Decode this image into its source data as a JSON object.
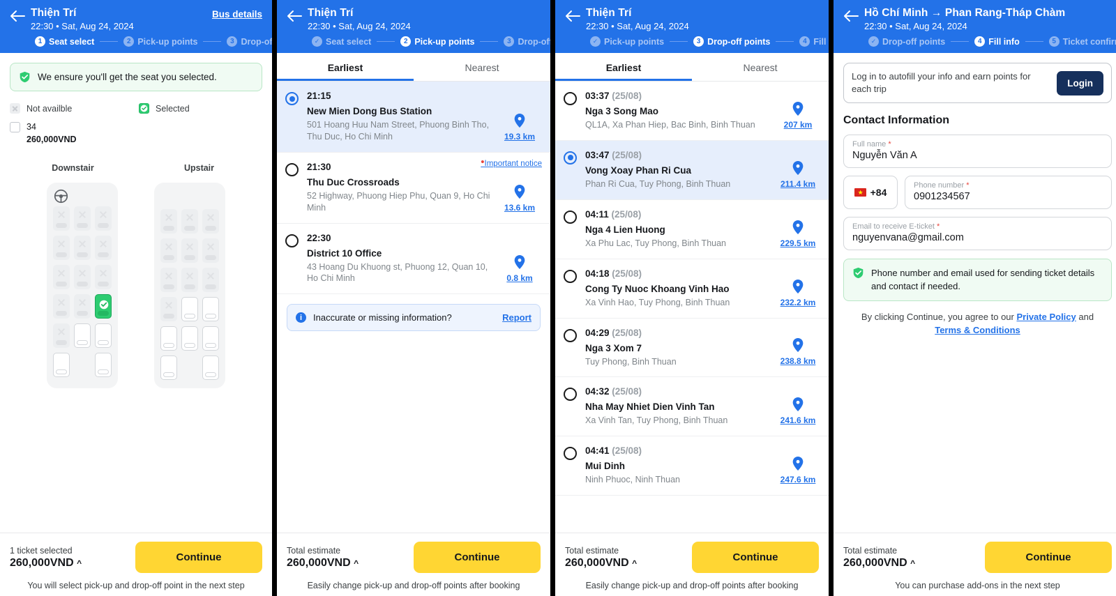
{
  "panels": {
    "seat_select": {
      "header": {
        "title": "Thiện Trí",
        "subtitle": "22:30 • Sat, Aug 24, 2024",
        "bus_details": "Bus details",
        "back_icon": "arrow-left-icon"
      },
      "steps": [
        {
          "num": "1",
          "label": "Seat select",
          "state": "active"
        },
        {
          "num": "2",
          "label": "Pick-up points",
          "state": "upcoming"
        },
        {
          "num": "3",
          "label": "Drop-off points",
          "state": "upcoming"
        }
      ],
      "ensure_banner": {
        "icon": "shield-check-icon",
        "text": "We ensure you'll get the seat you selected."
      },
      "legend": [
        {
          "key": "not_available",
          "label": "Not availble",
          "icon": "seat-unavailable-icon"
        },
        {
          "key": "selected",
          "label": "Selected",
          "icon": "seat-selected-icon"
        }
      ],
      "selected_seat": {
        "icon": "seat-available-icon",
        "number": "34",
        "price": "260,000VND"
      },
      "decks": [
        {
          "name": "Downstair",
          "has_wheel": true,
          "rows": [
            [
              "na",
              "na",
              "na"
            ],
            [
              "na",
              "na",
              "na"
            ],
            [
              "na",
              "na",
              "na"
            ],
            [
              "na",
              "na",
              "sel"
            ],
            [
              "na",
              "av",
              "av"
            ],
            [
              "av",
              "blank",
              "av"
            ]
          ]
        },
        {
          "name": "Upstair",
          "has_wheel": false,
          "rows": [
            [
              "na",
              "na",
              "na"
            ],
            [
              "na",
              "na",
              "na"
            ],
            [
              "na",
              "na",
              "na"
            ],
            [
              "na",
              "av",
              "av"
            ],
            [
              "av",
              "av",
              "av"
            ],
            [
              "av",
              "blank",
              "av"
            ]
          ]
        }
      ],
      "footer": {
        "label": "1 ticket selected",
        "price": "260,000VND",
        "caret": "^",
        "button": "Continue",
        "note": "You will select pick-up and drop-off point in the next step"
      }
    },
    "pickup_points": {
      "header": {
        "title": "Thiện Trí",
        "subtitle": "22:30 • Sat, Aug 24, 2024",
        "back_icon": "arrow-left-icon"
      },
      "steps": [
        {
          "num": "✓",
          "label": "Seat select",
          "state": "done"
        },
        {
          "num": "2",
          "label": "Pick-up points",
          "state": "active"
        },
        {
          "num": "3",
          "label": "Drop-off points",
          "state": "upcoming"
        }
      ],
      "tabs": [
        {
          "label": "Earliest",
          "selected": true
        },
        {
          "label": "Nearest",
          "selected": false
        }
      ],
      "stops": [
        {
          "time": "21:15",
          "date": "",
          "name": "New Mien Dong Bus Station",
          "address": "501 Hoang Huu Nam Street, Phuong Binh Tho, Thu Duc, Ho Chi Minh",
          "distance": "19.3 km",
          "selected": true,
          "notice": ""
        },
        {
          "time": "21:30",
          "date": "",
          "name": "Thu Duc Crossroads",
          "address": "52 Highway, Phuong Hiep Phu, Quan 9, Ho Chi Minh",
          "distance": "13.6 km",
          "selected": false,
          "notice": "Important notice"
        },
        {
          "time": "22:30",
          "date": "",
          "name": "District 10 Office",
          "address": "43 Hoang Du Khuong st, Phuong 12, Quan 10, Ho Chi Minh",
          "distance": "0.8 km",
          "selected": false,
          "notice": ""
        }
      ],
      "report_box": {
        "icon": "info-icon",
        "text": "Inaccurate or missing information?",
        "link": "Report"
      },
      "footer": {
        "label": "Total estimate",
        "price": "260,000VND",
        "caret": "^",
        "button": "Continue",
        "note": "Easily change pick-up and drop-off points after booking"
      }
    },
    "dropoff_points": {
      "header": {
        "title": "Thiện Trí",
        "subtitle": "22:30 • Sat, Aug 24, 2024",
        "back_icon": "arrow-left-icon"
      },
      "steps": [
        {
          "num": "✓",
          "label": "Pick-up points",
          "state": "done"
        },
        {
          "num": "3",
          "label": "Drop-off points",
          "state": "active"
        },
        {
          "num": "4",
          "label": "Fill info",
          "state": "upcoming"
        }
      ],
      "tabs": [
        {
          "label": "Earliest",
          "selected": true
        },
        {
          "label": "Nearest",
          "selected": false
        }
      ],
      "stops": [
        {
          "time": "03:37",
          "date": "(25/08)",
          "name": "Nga 3 Song Mao",
          "address": "QL1A, Xa Phan Hiep, Bac Binh, Binh Thuan",
          "distance": "207 km",
          "selected": false,
          "notice": ""
        },
        {
          "time": "03:47",
          "date": "(25/08)",
          "name": "Vong Xoay Phan Ri Cua",
          "address": "Phan Ri Cua, Tuy Phong, Binh Thuan",
          "distance": "211.4 km",
          "selected": true,
          "notice": ""
        },
        {
          "time": "04:11",
          "date": "(25/08)",
          "name": "Nga 4 Lien Huong",
          "address": "Xa Phu Lac, Tuy Phong, Binh Thuan",
          "distance": "229.5 km",
          "selected": false,
          "notice": ""
        },
        {
          "time": "04:18",
          "date": "(25/08)",
          "name": "Cong Ty Nuoc Khoang Vinh Hao",
          "address": "Xa Vinh Hao, Tuy Phong, Binh Thuan",
          "distance": "232.2 km",
          "selected": false,
          "notice": ""
        },
        {
          "time": "04:29",
          "date": "(25/08)",
          "name": "Nga 3 Xom 7",
          "address": "Tuy Phong, Binh Thuan",
          "distance": "238.8 km",
          "selected": false,
          "notice": ""
        },
        {
          "time": "04:32",
          "date": "(25/08)",
          "name": "Nha May Nhiet Dien Vinh Tan",
          "address": "Xa Vinh Tan, Tuy Phong, Binh Thuan",
          "distance": "241.6 km",
          "selected": false,
          "notice": ""
        },
        {
          "time": "04:41",
          "date": "(25/08)",
          "name": "Mui Dinh",
          "address": "Ninh Phuoc, Ninh Thuan",
          "distance": "247.6 km",
          "selected": false,
          "notice": ""
        }
      ],
      "footer": {
        "label": "Total estimate",
        "price": "260,000VND",
        "caret": "^",
        "button": "Continue",
        "note": "Easily change pick-up and drop-off points after booking"
      }
    },
    "fill_info": {
      "header": {
        "title": "Hồ Chí Minh → Phan Rang-Tháp Chàm",
        "subtitle": "22:30 • Sat, Aug 24, 2024",
        "back_icon": "arrow-left-icon"
      },
      "steps": [
        {
          "num": "✓",
          "label": "Drop-off points",
          "state": "done"
        },
        {
          "num": "4",
          "label": "Fill info",
          "state": "active"
        },
        {
          "num": "5",
          "label": "Ticket confirmation",
          "state": "upcoming"
        }
      ],
      "login_banner": {
        "text": "Log in to autofill your info and earn points for each trip",
        "button": "Login"
      },
      "section_title": "Contact Information",
      "fields": {
        "full_name": {
          "label": "Full name",
          "required": "*",
          "value": "Nguyễn Văn A"
        },
        "country_code": {
          "value": "+84",
          "flag": "vietnam-flag-icon"
        },
        "phone": {
          "label": "Phone number",
          "required": "*",
          "value": "0901234567"
        },
        "email": {
          "label": "Email to receive E-ticket",
          "required": "*",
          "value": "nguyenvana@gmail.com"
        }
      },
      "info_banner": {
        "icon": "shield-check-icon",
        "text": "Phone number and email used for sending ticket details and contact if needed."
      },
      "policy": {
        "prefix": "By clicking Continue, you agree to our ",
        "link1": "Private Policy",
        "mid": " and",
        "link2": "Terms & Conditions"
      },
      "footer": {
        "label": "Total estimate",
        "price": "260,000VND",
        "caret": "^",
        "button": "Continue",
        "note": "You can purchase add-ons in the next step"
      }
    }
  },
  "colors": {
    "brand_blue": "#2372e8",
    "accent_yellow": "#ffd633",
    "success_green": "#2ecc71",
    "navy": "#16305c",
    "link_blue": "#2372e8"
  }
}
